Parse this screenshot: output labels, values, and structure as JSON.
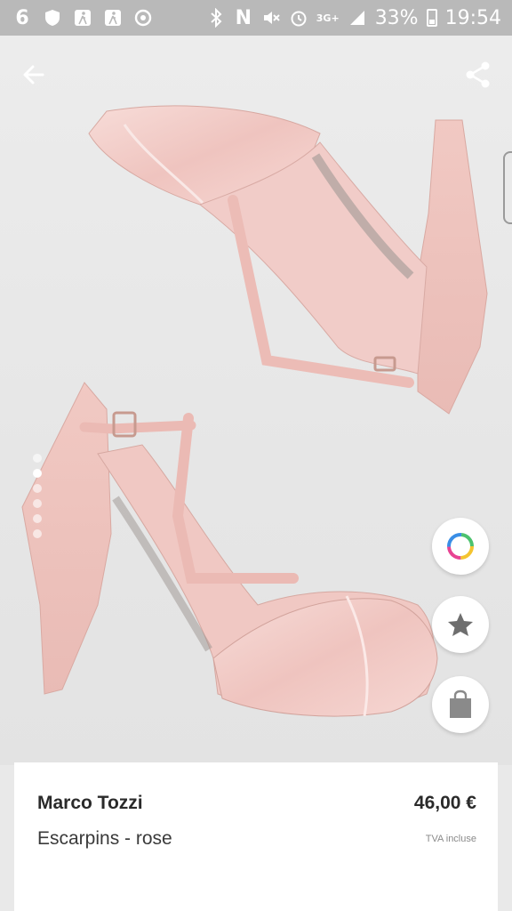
{
  "status_bar": {
    "left_icons": [
      "vodafone-icon",
      "shield-icon",
      "walk-icon",
      "walk-icon",
      "sync-icon"
    ],
    "network": "3G+",
    "battery": "33%",
    "time": "19:54"
  },
  "toolbar": {
    "back_icon": "arrow-left-icon",
    "share_icon": "share-icon"
  },
  "gallery": {
    "image_count": 6,
    "active_index": 1
  },
  "actions": {
    "color_icon": "color-wheel-icon",
    "favorite_icon": "star-icon",
    "bag_icon": "shopping-bag-icon"
  },
  "product": {
    "brand": "Marco Tozzi",
    "name": "Escarpins - rose",
    "price": "46,00 €",
    "tax_note": "TVA incluse"
  },
  "colors": {
    "status_bar": "#b9b9b9",
    "shoe_pink": "#eec2bd",
    "shoe_satin": "#f2cfcb",
    "background": "#e9e9e9"
  }
}
